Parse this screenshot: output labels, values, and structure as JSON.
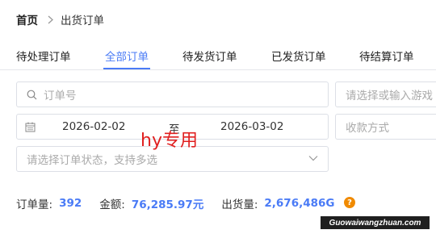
{
  "breadcrumb": {
    "home": "首页",
    "current": "出货订单"
  },
  "tabs": [
    {
      "label": "待处理订单"
    },
    {
      "label": "全部订单"
    },
    {
      "label": "待发货订单"
    },
    {
      "label": "已发货订单"
    },
    {
      "label": "待结算订单"
    }
  ],
  "active_tab": "全部订单",
  "filters": {
    "order_placeholder": "订单号",
    "game_placeholder": "请选择或输入游戏",
    "date_start": "2026-02-02",
    "date_separator": "至",
    "date_end": "2026-03-02",
    "payment_placeholder": "收款方式",
    "status_placeholder": "请选择订单状态，支持多选"
  },
  "watermark": "hy专用",
  "summary": {
    "order_count_label": "订单量:",
    "order_count": "392",
    "amount_label": "金额:",
    "amount": "76,285.97元",
    "shipped_label": "出货量:",
    "shipped": "2,676,486G",
    "help_icon": "?"
  },
  "site_tag": "Guowaiwangzhuan.com",
  "colors": {
    "accent": "#4a7bf6",
    "warning": "#f08a00",
    "watermark": "#e02020"
  },
  "icons": [
    "chevron-right-icon",
    "search-icon",
    "calendar-icon",
    "chevron-down-icon",
    "help-icon"
  ]
}
